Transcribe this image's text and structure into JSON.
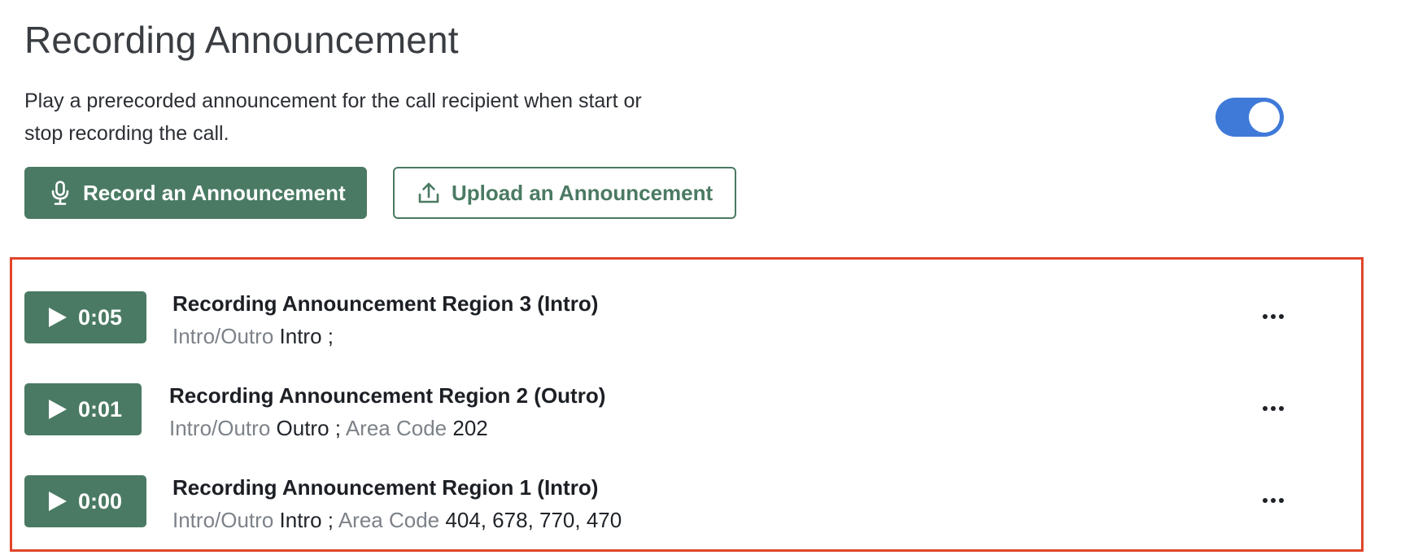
{
  "header": {
    "title": "Recording Announcement",
    "description": "Play a prerecorded announcement for the call recipient when start or stop recording the call."
  },
  "toggle": {
    "state": "on",
    "color": "#3f7ad8"
  },
  "actions": {
    "record_label": "Record an Announcement",
    "record_icon": "microphone-icon",
    "upload_label": "Upload an Announcement",
    "upload_icon": "upload-icon"
  },
  "colors": {
    "primary": "#4a7a63",
    "highlight_border": "#e0452b"
  },
  "recordings": [
    {
      "duration": "0:05",
      "title": "Recording Announcement Region 3 (Intro)",
      "intro_outro_label": "Intro/Outro",
      "intro_outro_value": "Intro",
      "separator": ";",
      "area_code_label": "",
      "area_code_value": ""
    },
    {
      "duration": "0:01",
      "title": "Recording Announcement Region 2 (Outro)",
      "intro_outro_label": "Intro/Outro",
      "intro_outro_value": "Outro",
      "separator": ";",
      "area_code_label": "Area Code",
      "area_code_value": "202"
    },
    {
      "duration": "0:00",
      "title": "Recording Announcement Region 1 (Intro)",
      "intro_outro_label": "Intro/Outro",
      "intro_outro_value": "Intro",
      "separator": ";",
      "area_code_label": "Area Code",
      "area_code_value": "404, 678, 770, 470"
    }
  ]
}
